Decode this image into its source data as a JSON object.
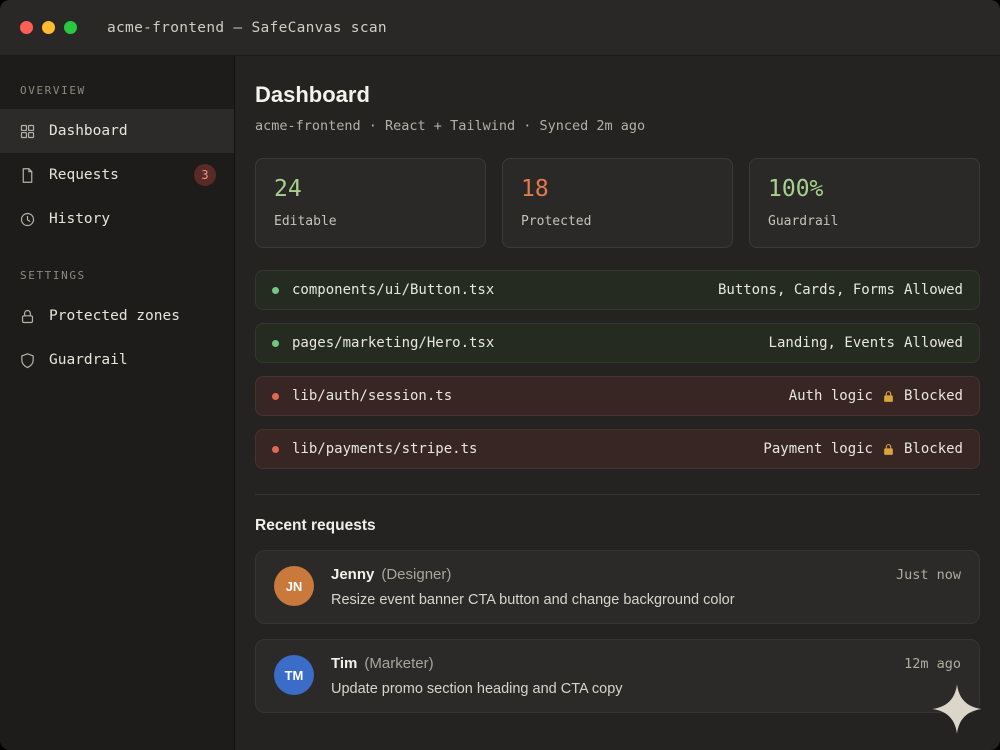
{
  "window": {
    "title": "acme-frontend — SafeCanvas scan"
  },
  "sidebar": {
    "sections": [
      {
        "label": "OVERVIEW",
        "items": [
          {
            "label": "Dashboard",
            "icon": "grid-icon",
            "active": true
          },
          {
            "label": "Requests",
            "icon": "document-icon",
            "badge": "3"
          },
          {
            "label": "History",
            "icon": "clock-icon"
          }
        ]
      },
      {
        "label": "SETTINGS",
        "items": [
          {
            "label": "Protected zones",
            "icon": "lock-icon"
          },
          {
            "label": "Guardrail",
            "icon": "shield-icon"
          }
        ]
      }
    ]
  },
  "main": {
    "title": "Dashboard",
    "subtitle": "acme-frontend · React + Tailwind · Synced 2m ago",
    "stats": [
      {
        "value": "24",
        "label": "Editable",
        "color": "#a7d28d"
      },
      {
        "value": "18",
        "label": "Protected",
        "color": "#e2794f"
      },
      {
        "value": "100%",
        "label": "Guardrail",
        "color": "#a7d28d"
      }
    ],
    "zones": [
      {
        "path": "components/ui/Button.tsx",
        "detail": "Buttons, Cards, Forms",
        "status": "Allowed",
        "type": "allowed"
      },
      {
        "path": "pages/marketing/Hero.tsx",
        "detail": "Landing, Events",
        "status": "Allowed",
        "type": "allowed"
      },
      {
        "path": "lib/auth/session.ts",
        "detail": "Auth logic",
        "status": "Blocked",
        "type": "blocked"
      },
      {
        "path": "lib/payments/stripe.ts",
        "detail": "Payment logic",
        "status": "Blocked",
        "type": "blocked"
      }
    ],
    "recent": {
      "heading": "Recent requests",
      "requests": [
        {
          "initials": "JN",
          "avatar_color": "#c9793b",
          "name": "Jenny",
          "role": "(Designer)",
          "time": "Just now",
          "message": "Resize event banner CTA button and change background color"
        },
        {
          "initials": "TM",
          "avatar_color": "#3b6cc7",
          "name": "Tim",
          "role": "(Marketer)",
          "time": "12m ago",
          "message": "Update promo section heading and CTA copy"
        }
      ]
    }
  },
  "colors": {
    "allowed_row_bg": "#252b20",
    "blocked_row_bg": "#382625",
    "allowed_dot": "#74c77e",
    "blocked_dot": "#de6a50",
    "badge_bg": "#5a2a26",
    "lock_gold": "#d9a43e"
  }
}
